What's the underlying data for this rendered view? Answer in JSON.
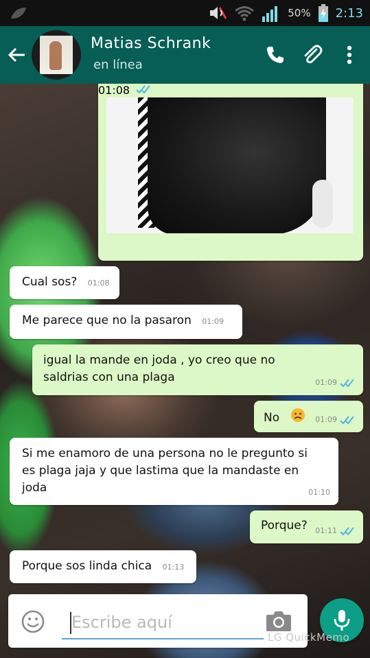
{
  "status_bar": {
    "battery_percent": "50%",
    "time": "2:13"
  },
  "header": {
    "contact_name": "Matias Schrank",
    "contact_status": "en línea"
  },
  "image_message": {
    "time": "01:08",
    "delivered": true
  },
  "messages": [
    {
      "direction": "in",
      "text": "Cual sos?",
      "time": "01:08"
    },
    {
      "direction": "in",
      "text": "Me parece que no la pasaron",
      "time": "01:09"
    },
    {
      "direction": "out",
      "text": "igual la mande en joda , yo creo que no saldrias con una plaga",
      "time": "01:09"
    },
    {
      "direction": "out",
      "text": "No",
      "emoji": "sad-face",
      "time": "01:09"
    },
    {
      "direction": "in",
      "text": "Si me enamoro de una persona no le pregunto si es plaga jaja y que lastima que la mandaste en joda",
      "time": "01:10"
    },
    {
      "direction": "out",
      "text": "Porque?",
      "time": "01:11"
    },
    {
      "direction": "in",
      "text": "Porque sos linda chica",
      "time": "01:13"
    }
  ],
  "input": {
    "placeholder": "Escribe aquí"
  },
  "watermark": "LG QuickMemo",
  "colors": {
    "header": "#075e54",
    "incoming_bubble": "#ffffff",
    "outgoing_bubble": "#dcf8c6",
    "tick_blue": "#4fb3e8",
    "mic_button": "#0d9e87"
  }
}
